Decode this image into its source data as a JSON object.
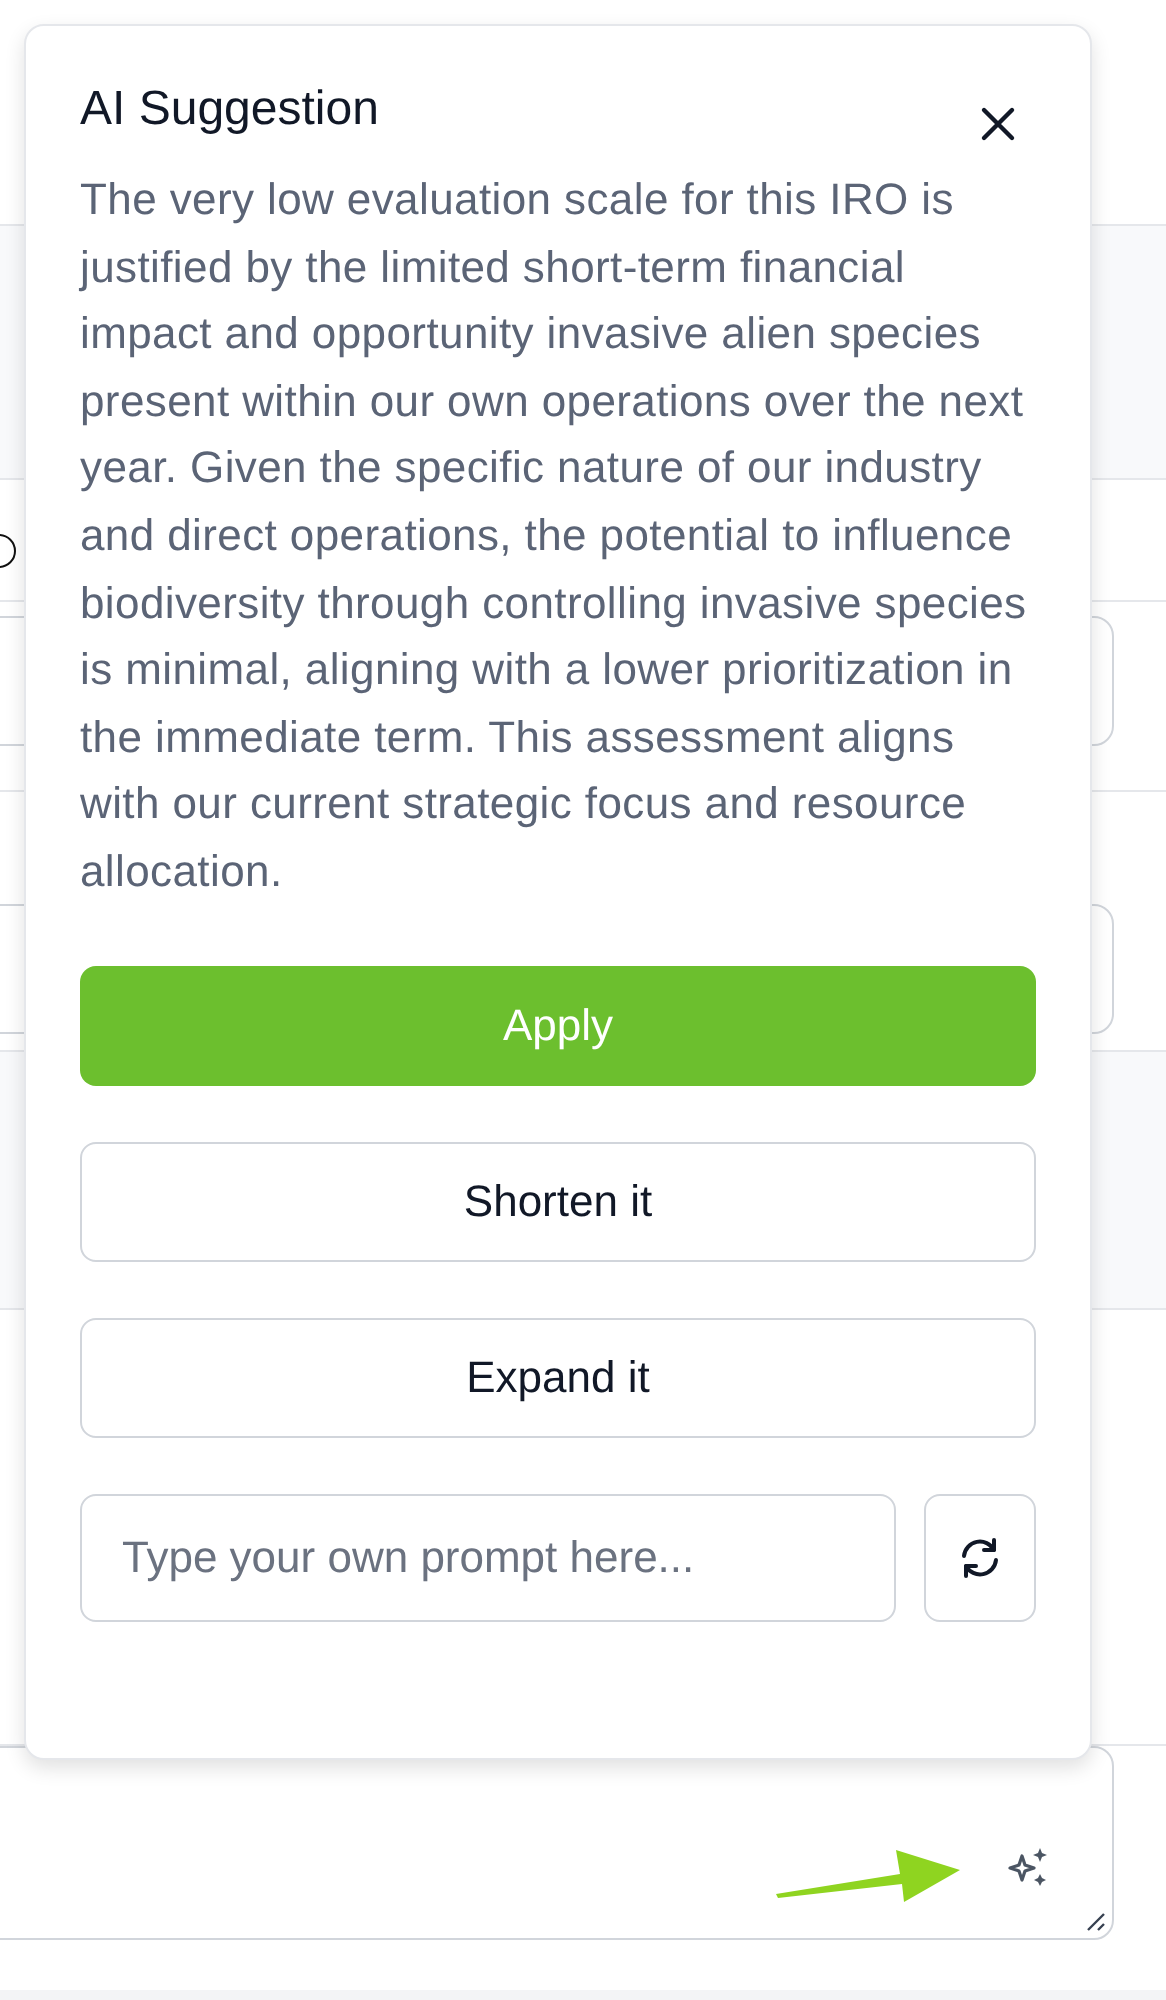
{
  "popup": {
    "title": "AI Suggestion",
    "body": "The very low evaluation scale for this IRO is justified by the limited short-term financial impact and opportunity invasive alien species present within our own operations over the next year. Given the specific nature of our industry and direct operations, the potential to influence biodiversity through controlling invasive species is minimal, aligning with a lower prioritization in the immediate term. This assessment aligns with our current strategic focus and resource allocation.",
    "actions": [
      {
        "label": "Apply",
        "kind": "primary"
      },
      {
        "label": "Shorten it",
        "kind": "secondary"
      },
      {
        "label": "Expand it",
        "kind": "secondary"
      }
    ],
    "prompt": {
      "placeholder": "Type your own prompt here..."
    }
  },
  "background": {
    "radio": {
      "checked": false
    }
  }
}
